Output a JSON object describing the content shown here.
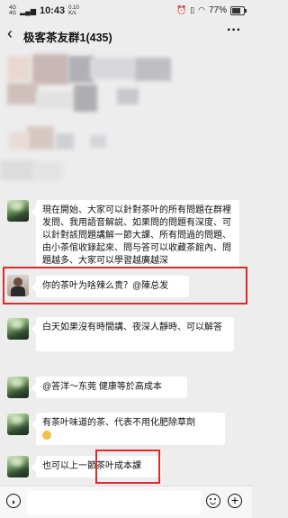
{
  "status_bar": {
    "network_label": "4G",
    "network_label_2": "4G",
    "speed_value": "0.10",
    "speed_unit": "K/s",
    "time": "10:43",
    "battery": "77%",
    "battery_level": 0.77
  },
  "header": {
    "back_icon": "chevron-left-icon",
    "title": "极客茶友群1(435)",
    "more_icon": "more-dots-icon"
  },
  "messages": [
    {
      "text": "現在開始、大家可以針對茶叶的所有問題在群裡发問、我用語音解説、如果問的問題有深度、可以針對該問題講解一節大課、所有問過的問題、由小茶倌收錄起來、問与答可以收藏茶館內、問題越多、大家可以學習越廣越深"
    },
    {
      "text": "你的茶叶为啥辣么贵？@陳总发"
    },
    {
      "text": "白天如果沒有時間講、夜深人靜時、可以解答"
    },
    {
      "text": "@答洋～东莞  健康等於高成本"
    },
    {
      "text": "有茶叶味道的茶、代表不用化肥除草劑"
    },
    {
      "text": "也可以上一節茶叶成本課"
    }
  ],
  "input_bar": {
    "voice_icon": "voice-icon",
    "emoji_icon": "emoji-icon",
    "plus_icon": "plus-icon"
  }
}
